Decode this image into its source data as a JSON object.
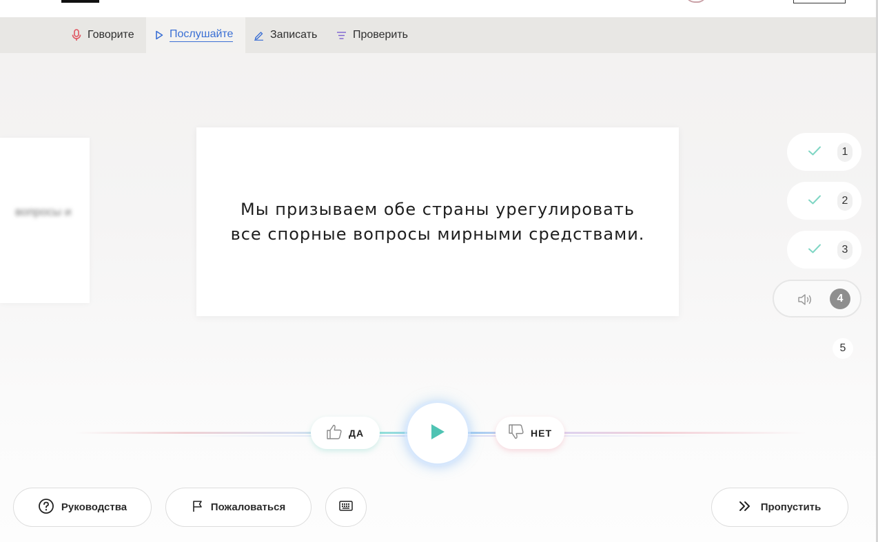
{
  "tabs": [
    {
      "label": "Говорите",
      "icon": "microphone-icon",
      "color": "#e0525e"
    },
    {
      "label": "Послушайте",
      "icon": "play-outline-icon",
      "color": "#3a6fd4",
      "active": true
    },
    {
      "label": "Записать",
      "icon": "pencil-icon",
      "color": "#3a6fd4"
    },
    {
      "label": "Проверить",
      "icon": "list-check-icon",
      "color": "#7b5fd0"
    }
  ],
  "previous_card": {
    "text": "вопросы и"
  },
  "sentence": "Мы призываем обе страны урегулировать все спорные вопросы мирными средствами.",
  "steps": [
    {
      "number": "1",
      "status": "done"
    },
    {
      "number": "2",
      "status": "done"
    },
    {
      "number": "3",
      "status": "done"
    },
    {
      "number": "4",
      "status": "current"
    },
    {
      "number": "5",
      "status": "pending"
    }
  ],
  "vote": {
    "yes_label": "ДА",
    "no_label": "НЕТ"
  },
  "footer": {
    "guides_label": "Руководства",
    "report_label": "Пожаловаться",
    "skip_label": "Пропустить"
  },
  "colors": {
    "accent_teal": "#4fc3b3",
    "accent_blue": "#3a6fd4",
    "accent_red": "#e0525e"
  }
}
